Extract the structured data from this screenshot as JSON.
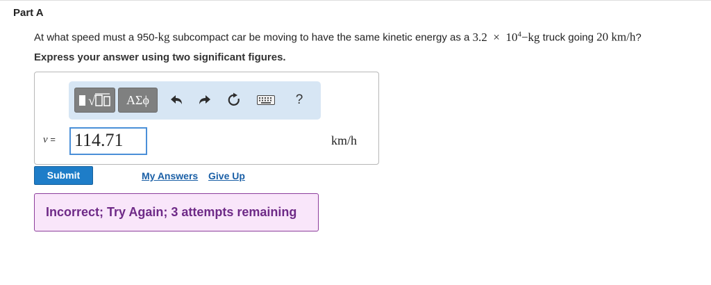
{
  "part": {
    "title": "Part A"
  },
  "question": {
    "t1": "At what speed must a 950-",
    "kg": "kg",
    "t2": " subcompact car be moving to have the same kinetic energy as a ",
    "coef": "3.2",
    "times": "×",
    "base": "10",
    "exp": "4",
    "dashkg": "−kg",
    "t3": " truck going ",
    "speed": "20 km/h",
    "t4": "?"
  },
  "instruction": "Express your answer using two significant figures.",
  "toolbar": {
    "templates_icon": "templates-icon",
    "greek_label": "ΑΣϕ",
    "undo_icon": "undo-icon",
    "redo_icon": "redo-icon",
    "reset_icon": "reset-icon",
    "keyboard_icon": "keyboard-icon",
    "help_label": "?"
  },
  "answer": {
    "var": "v",
    "eq": "=",
    "value": "114.71",
    "unit": "km/h"
  },
  "actions": {
    "submit": "Submit",
    "my_answers": "My Answers",
    "give_up": "Give Up"
  },
  "feedback": {
    "text": "Incorrect; Try Again; 3 attempts remaining"
  },
  "colors": {
    "submit_bg": "#1e7dc8",
    "link": "#1a5fa6",
    "feedback_bg": "#f9e6fa",
    "feedback_border": "#8c3d9b",
    "toolbar_bg": "#d7e6f4"
  }
}
